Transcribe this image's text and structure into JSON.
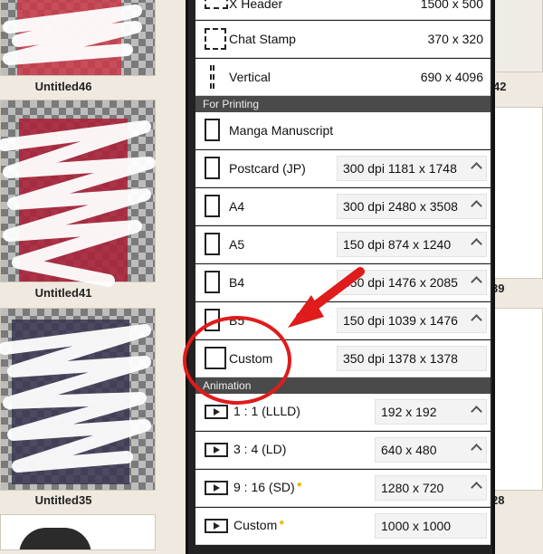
{
  "gallery": {
    "left_items": [
      {
        "label": "Untitled46"
      },
      {
        "label": "Untitled41"
      },
      {
        "label": "Untitled35"
      }
    ],
    "right_labels": [
      "42",
      "39",
      "28"
    ]
  },
  "panel": {
    "top_rows": [
      {
        "label": "X Header",
        "value": "1500 x 500"
      },
      {
        "label": "Chat Stamp",
        "value": "370 x  320"
      },
      {
        "label": "Vertical",
        "value": "690 x 4096"
      }
    ],
    "printing_section": "For Printing",
    "printing_rows": [
      {
        "label": "Manga Manuscript",
        "value": ""
      },
      {
        "label": "Postcard (JP)",
        "value": "300 dpi  1181 x 1748"
      },
      {
        "label": "A4",
        "value": "300 dpi  2480 x 3508"
      },
      {
        "label": "A5",
        "value": "150 dpi   874 x 1240"
      },
      {
        "label": "B4",
        "value": "350 dpi  1476 x 2085"
      },
      {
        "label": "B5",
        "value": "150 dpi  1039 x 1476"
      },
      {
        "label": "Custom",
        "value": "350 dpi 1378 x 1378"
      }
    ],
    "animation_section": "Animation",
    "animation_rows": [
      {
        "label": "1 : 1 (LLLD)",
        "value": "192 x  192",
        "dot": false
      },
      {
        "label": "3 : 4 (LD)",
        "value": "640 x  480",
        "dot": false
      },
      {
        "label": "9 : 16 (SD)",
        "value": "1280 x  720",
        "dot": true
      },
      {
        "label": "Custom",
        "value": "1000 x 1000",
        "dot": true
      }
    ]
  },
  "colors": {
    "annotation_red": "#e01b1b",
    "panel_dark": "#222222"
  }
}
